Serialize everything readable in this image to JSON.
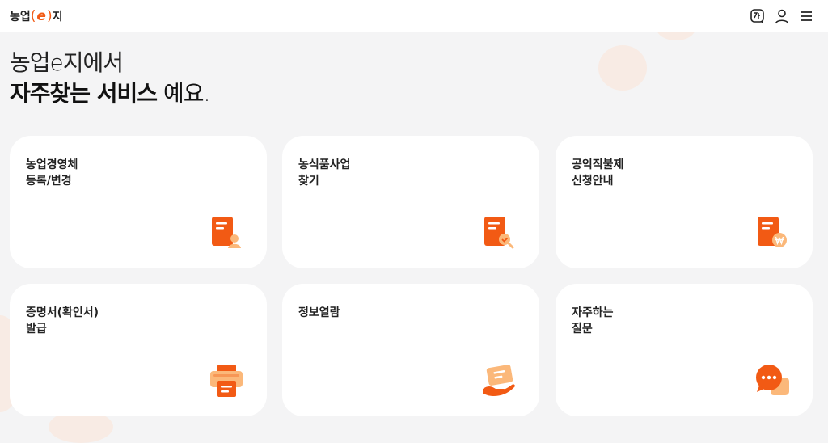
{
  "header": {
    "logo_prefix": "농업",
    "logo_paren_open": "(",
    "logo_e": "e",
    "logo_paren_close": ")",
    "logo_suffix": "지",
    "icons": [
      "language-icon",
      "user-icon",
      "menu-icon"
    ]
  },
  "hero": {
    "line1": "농업e지에서",
    "line2_bold": "자주찾는 서비스",
    "line2_rest": " 예요."
  },
  "cards": [
    {
      "line1": "농업경영체",
      "line2": "등록/변경",
      "icon": "document-person-icon"
    },
    {
      "line1": "농식품사업",
      "line2": "찾기",
      "icon": "document-search-icon"
    },
    {
      "line1": "공익직불제",
      "line2": "신청안내",
      "icon": "document-won-icon"
    },
    {
      "line1": "증명서(확인서)",
      "line2": "발급",
      "icon": "printer-icon"
    },
    {
      "line1": "정보열람",
      "line2": "",
      "icon": "hand-document-icon"
    },
    {
      "line1": "자주하는",
      "line2": "질문",
      "icon": "chat-bubble-icon"
    }
  ],
  "colors": {
    "accent": "#f25a14",
    "accent_light": "#fbb87a",
    "background": "#f4f4f5"
  }
}
